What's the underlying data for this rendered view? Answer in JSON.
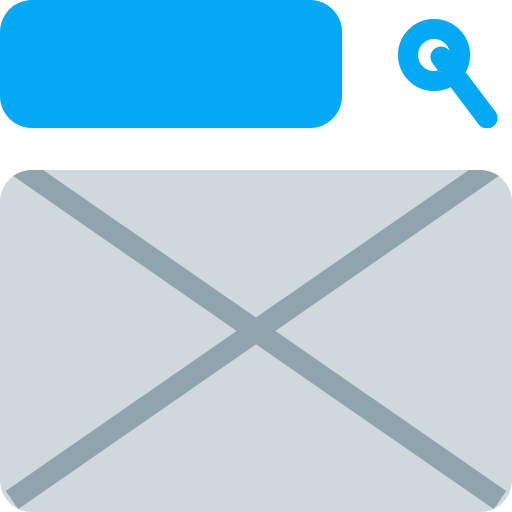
{
  "search": {
    "query": "",
    "icon": "search-icon",
    "bar_color": "#03A9F4"
  },
  "placeholder": {
    "icon": "image-placeholder-icon",
    "fill_color": "#CFD8DC",
    "cross_color": "#90A4AE"
  }
}
